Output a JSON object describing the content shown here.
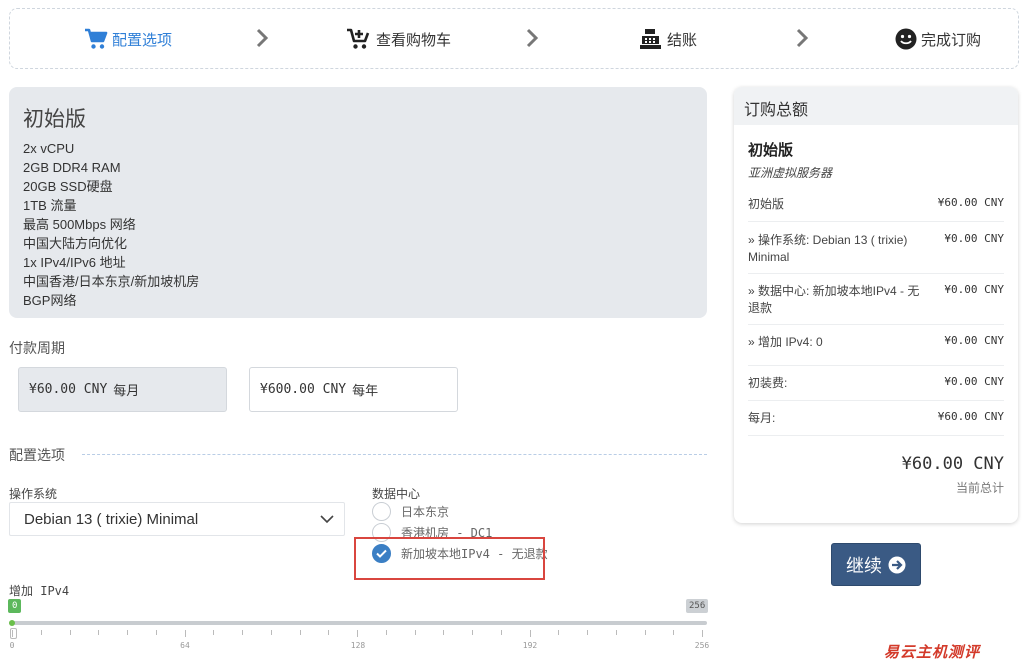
{
  "steps": [
    {
      "label": "配置选项",
      "icon": "cart-icon",
      "active": true
    },
    {
      "label": "查看购物车",
      "icon": "cart-plus-icon",
      "active": false
    },
    {
      "label": "结账",
      "icon": "cash-register-icon",
      "active": false
    },
    {
      "label": "完成订购",
      "icon": "smile-icon",
      "active": false
    }
  ],
  "product": {
    "name": "初始版",
    "features": [
      "2x vCPU",
      "2GB DDR4 RAM",
      "20GB SSD硬盘",
      "1TB 流量",
      "最高 500Mbps 网络",
      "中国大陆方向优化",
      "1x IPv4/IPv6 地址",
      "中国香港/日本东京/新加坡机房",
      "BGP网络"
    ]
  },
  "billing": {
    "title": "付款周期",
    "options": [
      {
        "price": "¥60.00 CNY",
        "unit": "每月",
        "selected": true
      },
      {
        "price": "¥600.00 CNY",
        "unit": "每年",
        "selected": false
      }
    ]
  },
  "config": {
    "title": "配置选项",
    "os_label": "操作系统",
    "os_value": "Debian 13 ( trixie) Minimal",
    "datacenter_label": "数据中心",
    "datacenters": [
      {
        "label": "日本东京",
        "checked": false
      },
      {
        "label": "香港机房 - DC1",
        "checked": false
      },
      {
        "label": "新加坡本地IPv4 - 无退款",
        "checked": true
      }
    ],
    "ipv4_label": "增加 IPv4",
    "slider": {
      "min": "0",
      "max": "256",
      "value": 0,
      "ticks": [
        "0",
        "64",
        "128",
        "192",
        "256"
      ]
    }
  },
  "summary": {
    "title": "订购总额",
    "product": "初始版",
    "group": "亚洲虚拟服务器",
    "lines": [
      {
        "label": "初始版",
        "value": "¥60.00 CNY"
      },
      {
        "label": " » 操作系统: Debian 13 ( trixie) Minimal",
        "value": "¥0.00 CNY"
      },
      {
        "label": " » 数据中心: 新加坡本地IPv4 - 无退款",
        "value": "¥0.00 CNY"
      },
      {
        "label": " » 增加 IPv4: 0",
        "value": "¥0.00 CNY"
      },
      {
        "label": "初装费:",
        "value": "¥0.00 CNY"
      },
      {
        "label": "每月:",
        "value": "¥60.00 CNY"
      }
    ],
    "total": "¥60.00 CNY",
    "total_label": "当前总计"
  },
  "continue_label": "继续",
  "watermark": "易云主机测评",
  "colors": {
    "accent": "#2f7fd7",
    "button": "#3a5a84",
    "highlight": "#d9463f",
    "panel": "#e6e9ed"
  }
}
